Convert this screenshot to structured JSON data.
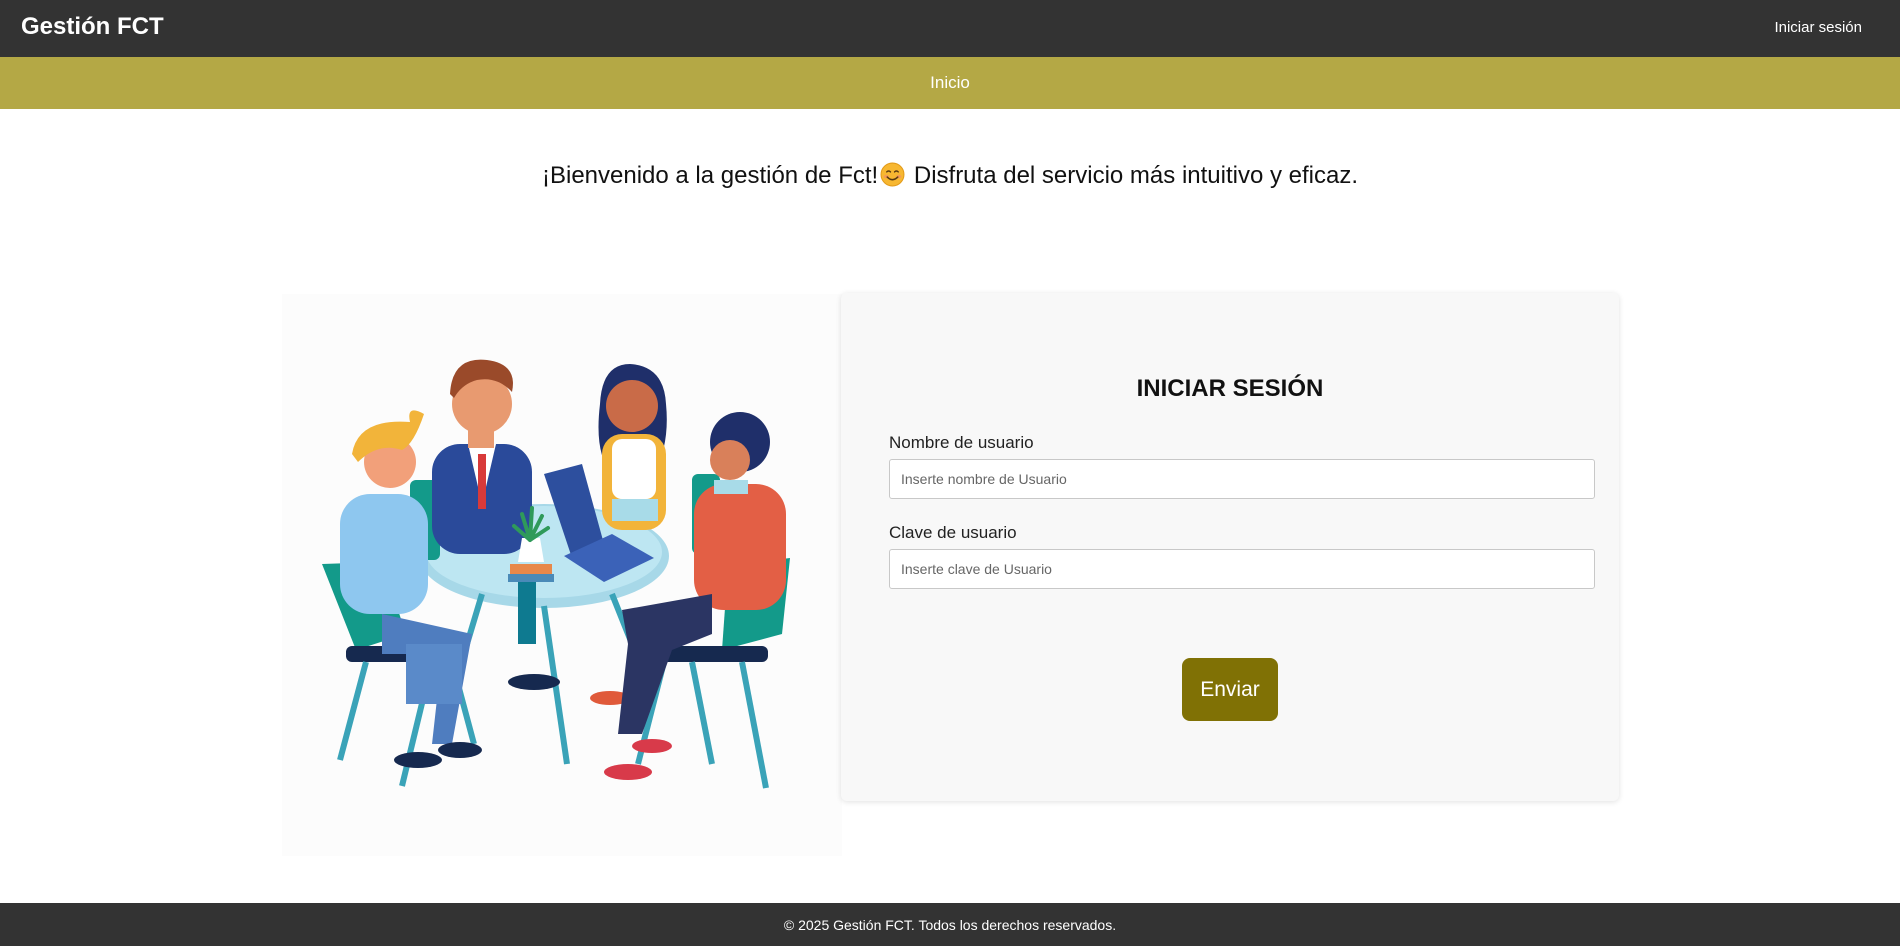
{
  "header": {
    "brand": "Gestión FCT",
    "login_link": "Iniciar sesión"
  },
  "nav": {
    "items": [
      {
        "label": "Inicio"
      }
    ]
  },
  "welcome": {
    "part1": "¡Bienvenido a la gestión de Fct!",
    "emoji_icon": "smiling-face-icon",
    "part2": "Disfruta del servicio más intuitivo y eficaz."
  },
  "illustration": {
    "icon": "team-meeting-illustration"
  },
  "login_form": {
    "title": "INICIAR SESIÓN",
    "username_label": "Nombre de usuario",
    "username_placeholder": "Inserte nombre de Usuario",
    "username_value": "",
    "password_label": "Clave de usuario",
    "password_placeholder": "Inserte clave de Usuario",
    "password_value": "",
    "submit_label": "Enviar"
  },
  "footer": {
    "text": "© 2025 Gestión FCT. Todos los derechos reservados."
  },
  "colors": {
    "header_bg": "#333333",
    "nav_bg": "#b4a845",
    "button_bg": "#807105",
    "card_bg": "#f8f8f8"
  }
}
